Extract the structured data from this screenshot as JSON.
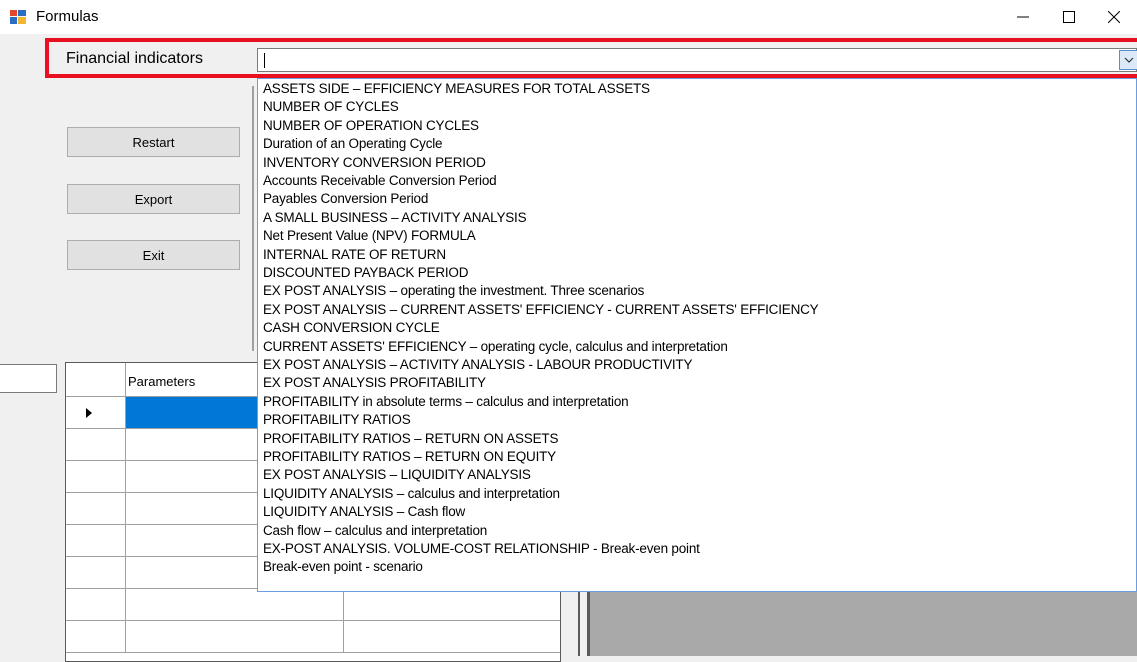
{
  "window": {
    "title": "Formulas"
  },
  "header": {
    "label": "Financial indicators",
    "combo_value": ""
  },
  "buttons": {
    "restart": "Restart",
    "export": "Export",
    "exit": "Exit"
  },
  "grid": {
    "column_header": "Parameters"
  },
  "dropdown": {
    "items": [
      "ASSETS SIDE – EFFICIENCY MEASURES FOR TOTAL ASSETS",
      "NUMBER OF CYCLES",
      "NUMBER OF OPERATION CYCLES",
      "Duration of an Operating Cycle",
      "INVENTORY CONVERSION PERIOD",
      "Accounts Receivable Conversion Period",
      "Payables Conversion Period",
      "A SMALL BUSINESS – ACTIVITY ANALYSIS",
      "Net Present Value (NPV) FORMULA",
      "INTERNAL RATE OF RETURN",
      "DISCOUNTED PAYBACK PERIOD",
      "EX POST ANALYSIS – operating the investment. Three scenarios",
      "EX POST ANALYSIS – CURRENT ASSETS' EFFICIENCY - CURRENT ASSETS' EFFICIENCY",
      "CASH CONVERSION CYCLE",
      "CURRENT ASSETS' EFFICIENCY – operating cycle, calculus and interpretation",
      "EX POST ANALYSIS – ACTIVITY ANALYSIS - LABOUR PRODUCTIVITY",
      "EX POST ANALYSIS PROFITABILITY",
      "PROFITABILITY in absolute terms – calculus and interpretation",
      "PROFITABILITY RATIOS",
      "PROFITABILITY RATIOS – RETURN ON ASSETS",
      "PROFITABILITY RATIOS – RETURN ON EQUITY",
      "EX POST ANALYSIS – LIQUIDITY ANALYSIS",
      "LIQUIDITY ANALYSIS – calculus and interpretation",
      "LIQUIDITY ANALYSIS – Cash flow",
      "Cash flow – calculus and interpretation",
      "EX-POST ANALYSIS. VOLUME-COST RELATIONSHIP - Break-even point",
      "Break-even point - scenario"
    ]
  },
  "colors": {
    "highlight": "#e8101e",
    "selection": "#0078d7",
    "pane": "#a9a9a9"
  }
}
